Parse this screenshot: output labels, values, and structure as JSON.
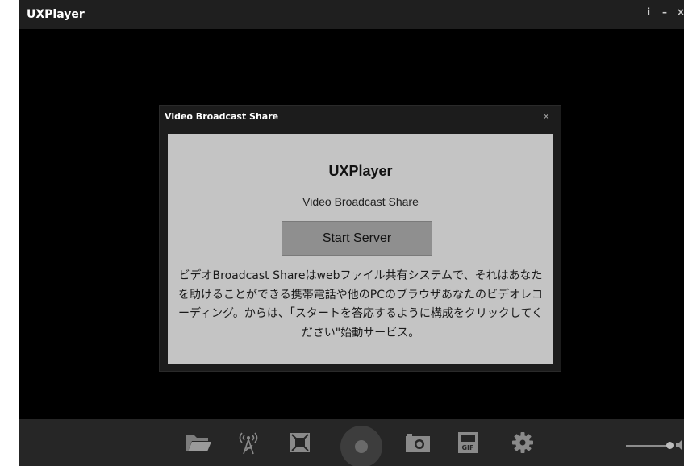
{
  "window": {
    "title": "UXPlayer",
    "info_glyph": "i",
    "minimize_glyph": "–",
    "close_glyph": "×"
  },
  "dialog": {
    "title": "Video Broadcast Share",
    "close_glyph": "×",
    "app_name": "UXPlayer",
    "subtitle": "Video Broadcast Share",
    "start_button": "Start Server",
    "description": "ビデオBroadcast Shareはwebファイル共有システムで、それはあなたを助けることができる携帯電話や他のPCのブラウザあなたのビデオレコーディング。からは、「スタートを答応するように構成をクリックしてください\"始動サービス。"
  },
  "controls": {
    "icons": [
      "folder-open-icon",
      "broadcast-tower-icon",
      "fullscreen-icon",
      "play-icon",
      "camera-icon",
      "gif-icon",
      "gear-icon",
      "volume-icon"
    ],
    "gif_label": "GIF"
  },
  "colors": {
    "titlebar": "#1f1f1f",
    "video_background": "#000000",
    "dialog_frame": "#1c1c1c",
    "dialog_panel": "#c4c4c4",
    "start_button": "#8f8f8f",
    "control_bar": "#262626",
    "icon_gray": "#8a8a8a"
  }
}
